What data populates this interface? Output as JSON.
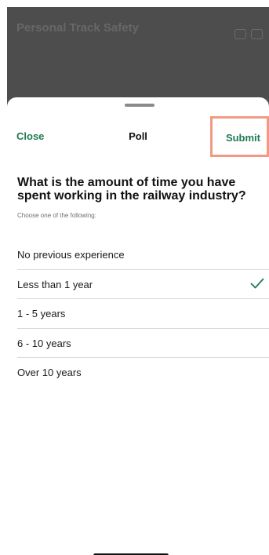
{
  "background": {
    "title": "Personal Track Safety",
    "icons": [
      "car-icon",
      "message-icon"
    ]
  },
  "header": {
    "close_label": "Close",
    "title": "Poll",
    "submit_label": "Submit"
  },
  "question": "What is the amount of time you have spent working in the railway industry?",
  "instruction": "Choose one of the following:",
  "options": [
    {
      "label": "No previous experience",
      "selected": false
    },
    {
      "label": "Less than 1 year",
      "selected": true
    },
    {
      "label": "1 - 5 years",
      "selected": false
    },
    {
      "label": "6 - 10 years",
      "selected": false
    },
    {
      "label": "Over 10 years",
      "selected": false
    }
  ],
  "colors": {
    "accent": "#1e7b52",
    "highlight": "#f29983"
  }
}
